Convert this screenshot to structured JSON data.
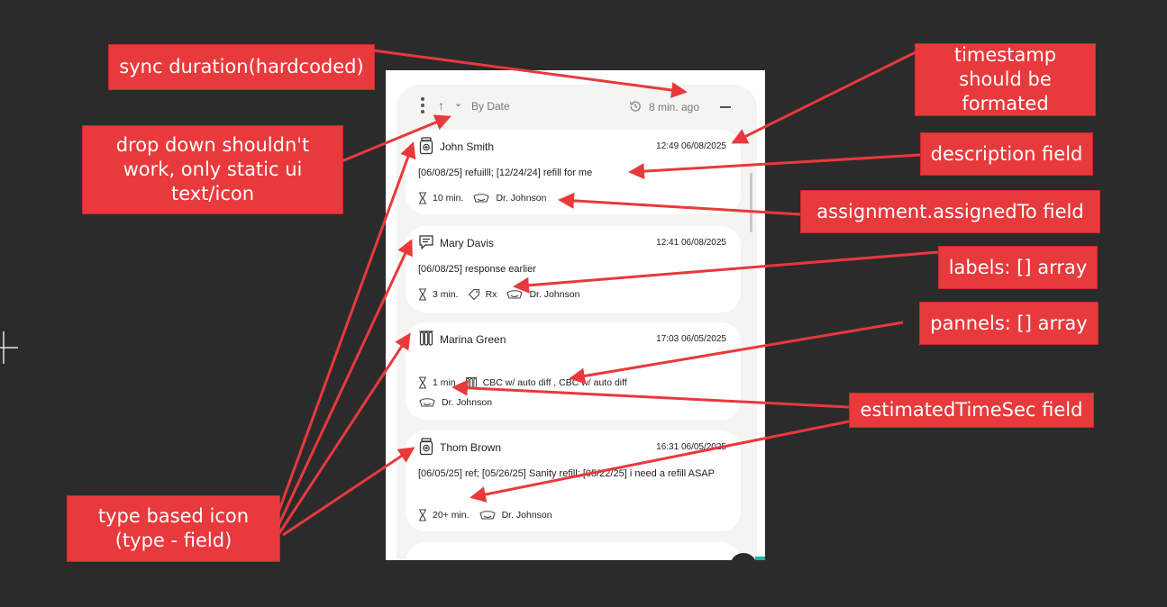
{
  "widget": {
    "sort_arrow": "↑",
    "sort_chevron": "⌄",
    "sort_label": "By Date",
    "sync_label": "8 min. ago",
    "icons": {
      "menu": "kebab-menu-icon",
      "sort": "arrow-up-icon",
      "chevron": "chevron-down-icon",
      "history": "history-clock-icon",
      "minimize": "minimize-icon"
    }
  },
  "tasks": [
    {
      "type_icon": "pill-bottle-icon",
      "name": "John Smith",
      "timestamp": "12:49 06/08/2025",
      "description": "[06/08/25] refuilll; [12/24/24] refill for me",
      "estimate": "10 min.",
      "assigned_to": "Dr. Johnson"
    },
    {
      "type_icon": "message-icon",
      "name": "Mary Davis",
      "timestamp": "12:41 06/08/2025",
      "description": "[06/08/25] response earlier",
      "estimate": "3 min.",
      "label": "Rx",
      "assigned_to": "Dr. Johnson"
    },
    {
      "type_icon": "test-tubes-icon",
      "name": "Marina Green",
      "timestamp": "17:03 06/05/2025",
      "estimate": "1 min",
      "panels": "CBC w/ auto diff , CBC w/ auto diff",
      "assigned_to": "Dr. Johnson"
    },
    {
      "type_icon": "pill-bottle-icon",
      "name": "Thom Brown",
      "timestamp": "16:31 06/05/2025",
      "description": "[06/05/25] ref; [05/26/25] Sanity refill; [05/22/25] i need a refill ASAP",
      "estimate": "20+ min.",
      "assigned_to": "Dr. Johnson"
    }
  ],
  "annotations": {
    "sync_duration": "sync duration(hardcoded)",
    "dropdown": "drop down shouldn't work, only static ui text/icon",
    "timestamp": "timestamp should be formated",
    "description": "description field",
    "assignment": "assignment.assignedTo field",
    "labels": "labels: [] array",
    "panels": "pannels: [] array",
    "estimated_time": "estimatedTimeSec field",
    "type_icon": "type based icon (type - field)"
  },
  "colors": {
    "background": "#2b2b2b",
    "callout": "#e8393c",
    "arrow": "#e8393c",
    "panel": "#f4f4f2",
    "card": "#ffffff"
  }
}
